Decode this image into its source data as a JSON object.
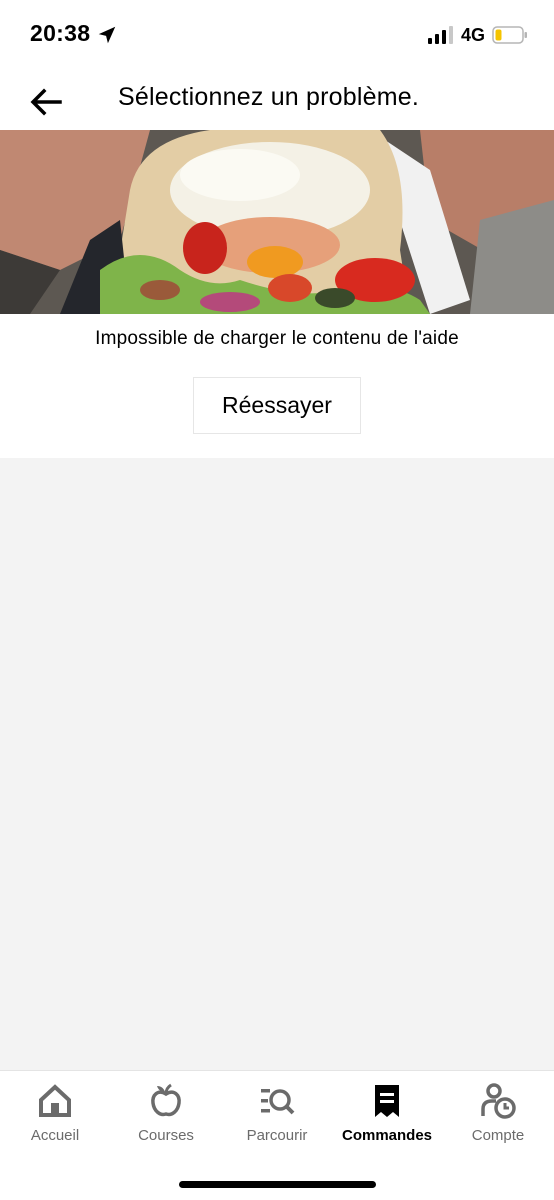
{
  "status_bar": {
    "time": "20:38",
    "network": "4G",
    "icons": [
      "location-arrow-icon",
      "signal-icon",
      "battery-icon"
    ],
    "battery_color": "#f5c400"
  },
  "header": {
    "title": "Sélectionnez un problème.",
    "back_icon": "arrow-left-icon"
  },
  "hero": {
    "image": "kebab-food-photo"
  },
  "content": {
    "error_text": "Impossible de charger le contenu de l'aide",
    "retry_label": "Réessayer"
  },
  "tab_bar": {
    "tabs": [
      {
        "label": "Accueil",
        "icon": "home-icon",
        "active": false
      },
      {
        "label": "Courses",
        "icon": "apple-icon",
        "active": false
      },
      {
        "label": "Parcourir",
        "icon": "browse-search-icon",
        "active": false
      },
      {
        "label": "Commandes",
        "icon": "receipt-icon",
        "active": true
      },
      {
        "label": "Compte",
        "icon": "account-icon",
        "active": false
      }
    ]
  },
  "colors": {
    "background": "#f3f3f3",
    "surface": "#ffffff",
    "text": "#000000",
    "inactive_tab": "#6b6b6b"
  }
}
